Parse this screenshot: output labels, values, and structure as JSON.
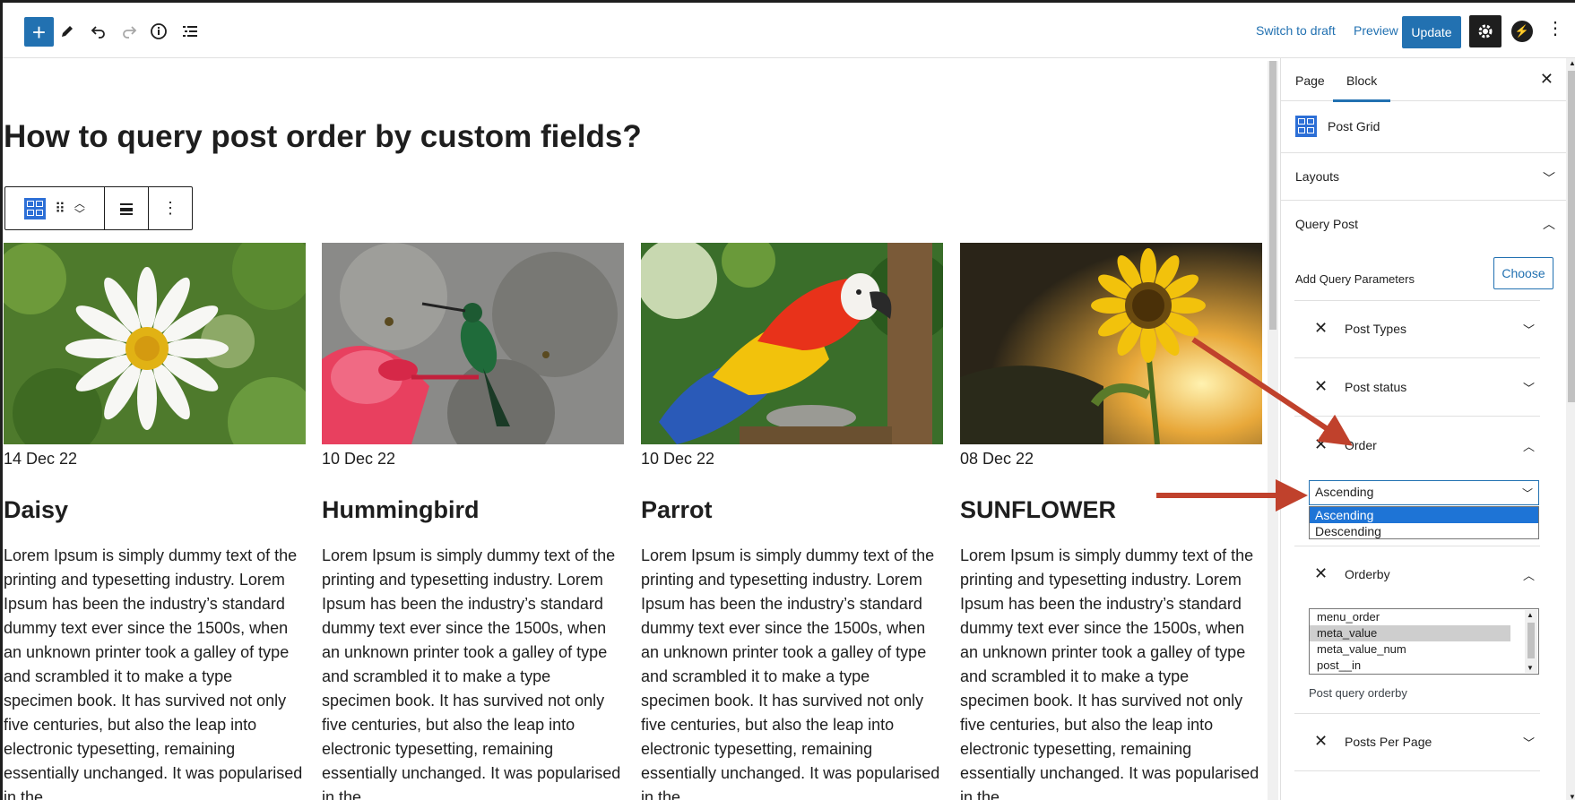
{
  "toolbar": {
    "switch_draft": "Switch to draft",
    "preview": "Preview",
    "update": "Update"
  },
  "post": {
    "title": "How to query post order by custom fields?"
  },
  "posts": [
    {
      "date": "14 Dec 22",
      "title": "Daisy",
      "excerpt": "Lorem Ipsum is simply dummy text of the printing and typesetting industry. Lorem Ipsum has been the industry’s standard dummy text ever since the 1500s, when an unknown printer took a galley of type and scrambled it to make a type specimen book. It has survived not only five centuries, but also the leap into electronic typesetting, remaining essentially unchanged. It was popularised in the"
    },
    {
      "date": "10 Dec 22",
      "title": "Hummingbird",
      "excerpt": "Lorem Ipsum is simply dummy text of the printing and typesetting industry. Lorem Ipsum has been the industry’s standard dummy text ever since the 1500s, when an unknown printer took a galley of type and scrambled it to make a type specimen book. It has survived not only five centuries, but also the leap into electronic typesetting, remaining essentially unchanged. It was popularised in the"
    },
    {
      "date": "10 Dec 22",
      "title": "Parrot",
      "excerpt": "Lorem Ipsum is simply dummy text of the printing and typesetting industry. Lorem Ipsum has been the industry’s standard dummy text ever since the 1500s, when an unknown printer took a galley of type and scrambled it to make a type specimen book. It has survived not only five centuries, but also the leap into electronic typesetting, remaining essentially unchanged. It was popularised in the"
    },
    {
      "date": "08 Dec 22",
      "title": "SUNFLOWER",
      "excerpt": "Lorem Ipsum is simply dummy text of the printing and typesetting industry. Lorem Ipsum has been the industry’s standard dummy text ever since the 1500s, when an unknown printer took a galley of type and scrambled it to make a type specimen book. It has survived not only five centuries, but also the leap into electronic typesetting, remaining essentially unchanged. It was popularised in the"
    }
  ],
  "sidebar": {
    "tab_page": "Page",
    "tab_block": "Block",
    "block_name": "Post Grid",
    "layouts": "Layouts",
    "query_post": "Query Post",
    "add_params": "Add Query Parameters",
    "choose": "Choose",
    "params": {
      "post_types": "Post Types",
      "post_status": "Post status",
      "order": "Order",
      "orderby": "Orderby",
      "posts_per_page": "Posts Per Page"
    },
    "order_select": {
      "value": "Ascending",
      "options": [
        "Ascending",
        "Descending"
      ]
    },
    "orderby_list": {
      "options": [
        "menu_order",
        "meta_value",
        "meta_value_num",
        "post__in"
      ],
      "selected": "meta_value"
    },
    "orderby_help": "Post query orderby"
  },
  "colors": {
    "accent": "#2271b1",
    "annotation_arrow": "#c0412c"
  }
}
